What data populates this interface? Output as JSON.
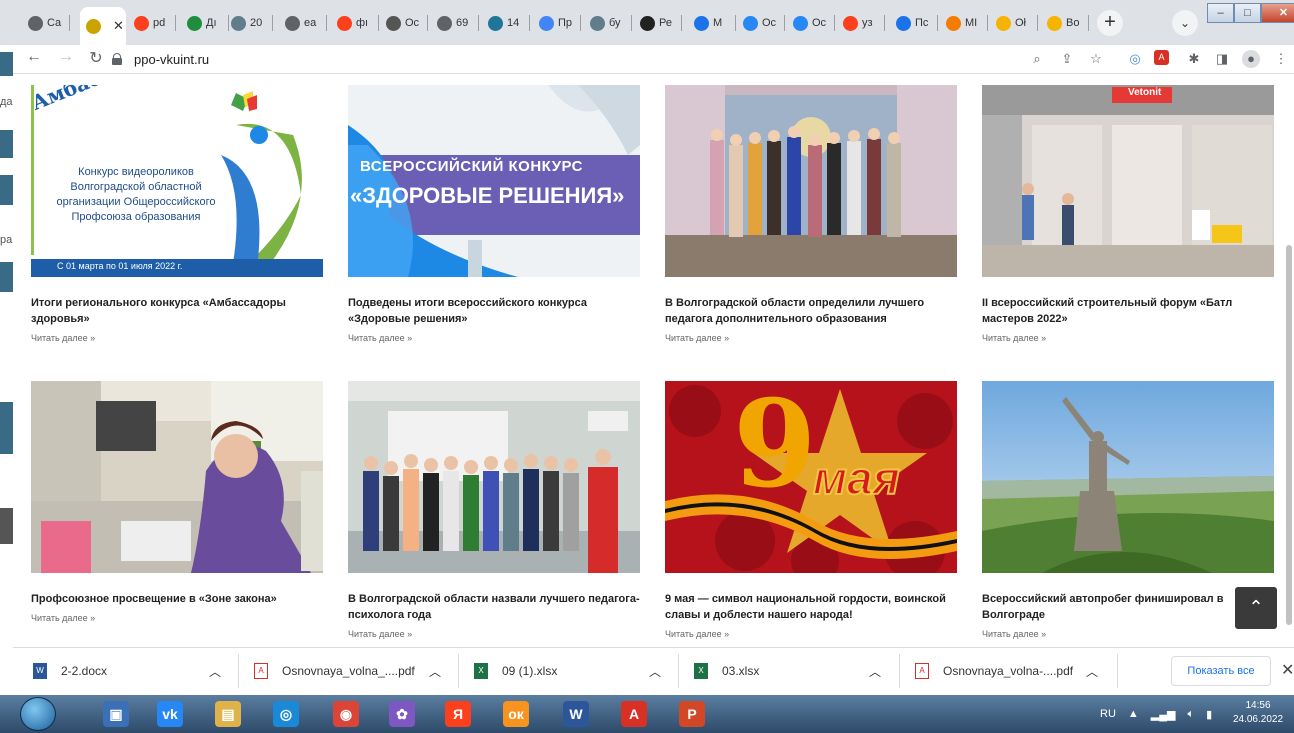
{
  "browser": {
    "tabs": [
      {
        "label": "Ca",
        "icon": "chrome-icon",
        "color": "#5f6368"
      },
      {
        "label": "",
        "icon": "site-favicon",
        "color": "#c9a400",
        "active": true
      },
      {
        "label": "pd",
        "icon": "yandex-icon",
        "color": "#fc3f1d"
      },
      {
        "label": "Дı",
        "icon": "green-dot-icon",
        "color": "#1e8e3e"
      },
      {
        "label": "20",
        "icon": "image-icon",
        "color": "#607d8b"
      },
      {
        "label": "ea",
        "icon": "chrome-icon",
        "color": "#5f6368"
      },
      {
        "label": "фı",
        "icon": "yandex-icon",
        "color": "#fc3f1d"
      },
      {
        "label": "Oc",
        "icon": "profile-icon",
        "color": "#555555"
      },
      {
        "label": "69",
        "icon": "chrome-icon",
        "color": "#5f6368"
      },
      {
        "label": "14",
        "icon": "wordpress-icon",
        "color": "#21759b"
      },
      {
        "label": "Пр",
        "icon": "diamond-icon",
        "color": "#4285f4"
      },
      {
        "label": "бу",
        "icon": "doc-icon",
        "color": "#607d8b"
      },
      {
        "label": "Ре",
        "icon": "k-icon",
        "color": "#222222"
      },
      {
        "label": "M",
        "icon": "message-icon",
        "color": "#1a73e8"
      },
      {
        "label": "Oc",
        "icon": "vk-icon",
        "color": "#2787f5"
      },
      {
        "label": "Oc",
        "icon": "vk-icon",
        "color": "#2787f5"
      },
      {
        "label": "уз",
        "icon": "yandex-icon",
        "color": "#fc3f1d"
      },
      {
        "label": "Пс",
        "icon": "mail-icon",
        "color": "#1a73e8"
      },
      {
        "label": "MI",
        "icon": "orange-dot-icon",
        "color": "#f57c00"
      },
      {
        "label": "Oł",
        "icon": "leaf-icon",
        "color": "#f4b400"
      },
      {
        "label": "Bo",
        "icon": "leaf-icon",
        "color": "#f4b400"
      }
    ],
    "url": "ppo-vkuint.ru"
  },
  "left_edge": {
    "text1": "да",
    "text2": "ра"
  },
  "cards": [
    {
      "title": "Итоги регионального конкурса «Амбассадоры здоровья»",
      "more": "Читать далее »",
      "img": {
        "banner_top": "Амбассадоры здоровья",
        "lines": [
          "Конкурс видеороликов",
          "Волгоградской областной",
          "организации Общероссийского",
          "Профсоюза образования"
        ],
        "dates": "С 01 марта по 01 июля 2022 г."
      }
    },
    {
      "title": "Подведены итоги всероссийского конкурса «Здоровые решения»",
      "more": "Читать далее »",
      "img": {
        "line1": "ВСЕРОССИЙСКИЙ КОНКУРС",
        "line2": "«ЗДОРОВЫЕ РЕШЕНИЯ»"
      }
    },
    {
      "title": "В Волгоградской области определили лучшего педагога дополнительного образования",
      "more": "Читать далее »"
    },
    {
      "title": "II всероссийский строительный форум «Батл мастеров 2022»",
      "more": "Читать далее »",
      "img": {
        "brand": "Vetonit"
      }
    },
    {
      "title": "Профсоюзное просвещение в «Зоне закона»",
      "more": "Читать далее »"
    },
    {
      "title": "В Волгоградской области назвали лучшего педагога-психолога года",
      "more": "Читать далее »"
    },
    {
      "title": "9 мая — символ национальной гордости, воинской славы и доблести нашего народа!",
      "more": "Читать далее »",
      "img": {
        "num": "9",
        "word": "мая"
      }
    },
    {
      "title": "Всероссийский автопробег финишировал в Волгограде",
      "more": "Читать далее »"
    }
  ],
  "downloads": {
    "items": [
      {
        "name": "2-2.docx",
        "type": "word",
        "color": "#2b579a"
      },
      {
        "name": "Osnovnaya_volna_....pdf",
        "type": "pdf",
        "color": "#d93025"
      },
      {
        "name": "09 (1).xlsx",
        "type": "excel",
        "color": "#1e7145"
      },
      {
        "name": "03.xlsx",
        "type": "excel",
        "color": "#1e7145"
      },
      {
        "name": "Osnovnaya_volna-....pdf",
        "type": "pdf",
        "color": "#d93025"
      }
    ],
    "show_all": "Показать все"
  },
  "taskbar": {
    "apps": [
      {
        "name": "save-app",
        "color": "#3b6fb6",
        "glyph": "▣"
      },
      {
        "name": "vk-app",
        "color": "#2787f5",
        "glyph": "vk"
      },
      {
        "name": "explorer-app",
        "color": "#e0b34a",
        "glyph": "▤"
      },
      {
        "name": "camera-app",
        "color": "#1a8ad8",
        "glyph": "◎"
      },
      {
        "name": "chrome-app",
        "color": "#db4437",
        "glyph": "◉"
      },
      {
        "name": "paint-app",
        "color": "#7e57c2",
        "glyph": "✿"
      },
      {
        "name": "yandex-app",
        "color": "#fc3f1d",
        "glyph": "Я"
      },
      {
        "name": "ok-app",
        "color": "#f7931e",
        "glyph": "ок"
      },
      {
        "name": "word-app",
        "color": "#2b579a",
        "glyph": "W"
      },
      {
        "name": "acrobat-app",
        "color": "#d93025",
        "glyph": "A"
      },
      {
        "name": "powerpoint-app",
        "color": "#d24726",
        "glyph": "P"
      }
    ],
    "lang": "RU",
    "time": "14:56",
    "date": "24.06.2022"
  }
}
